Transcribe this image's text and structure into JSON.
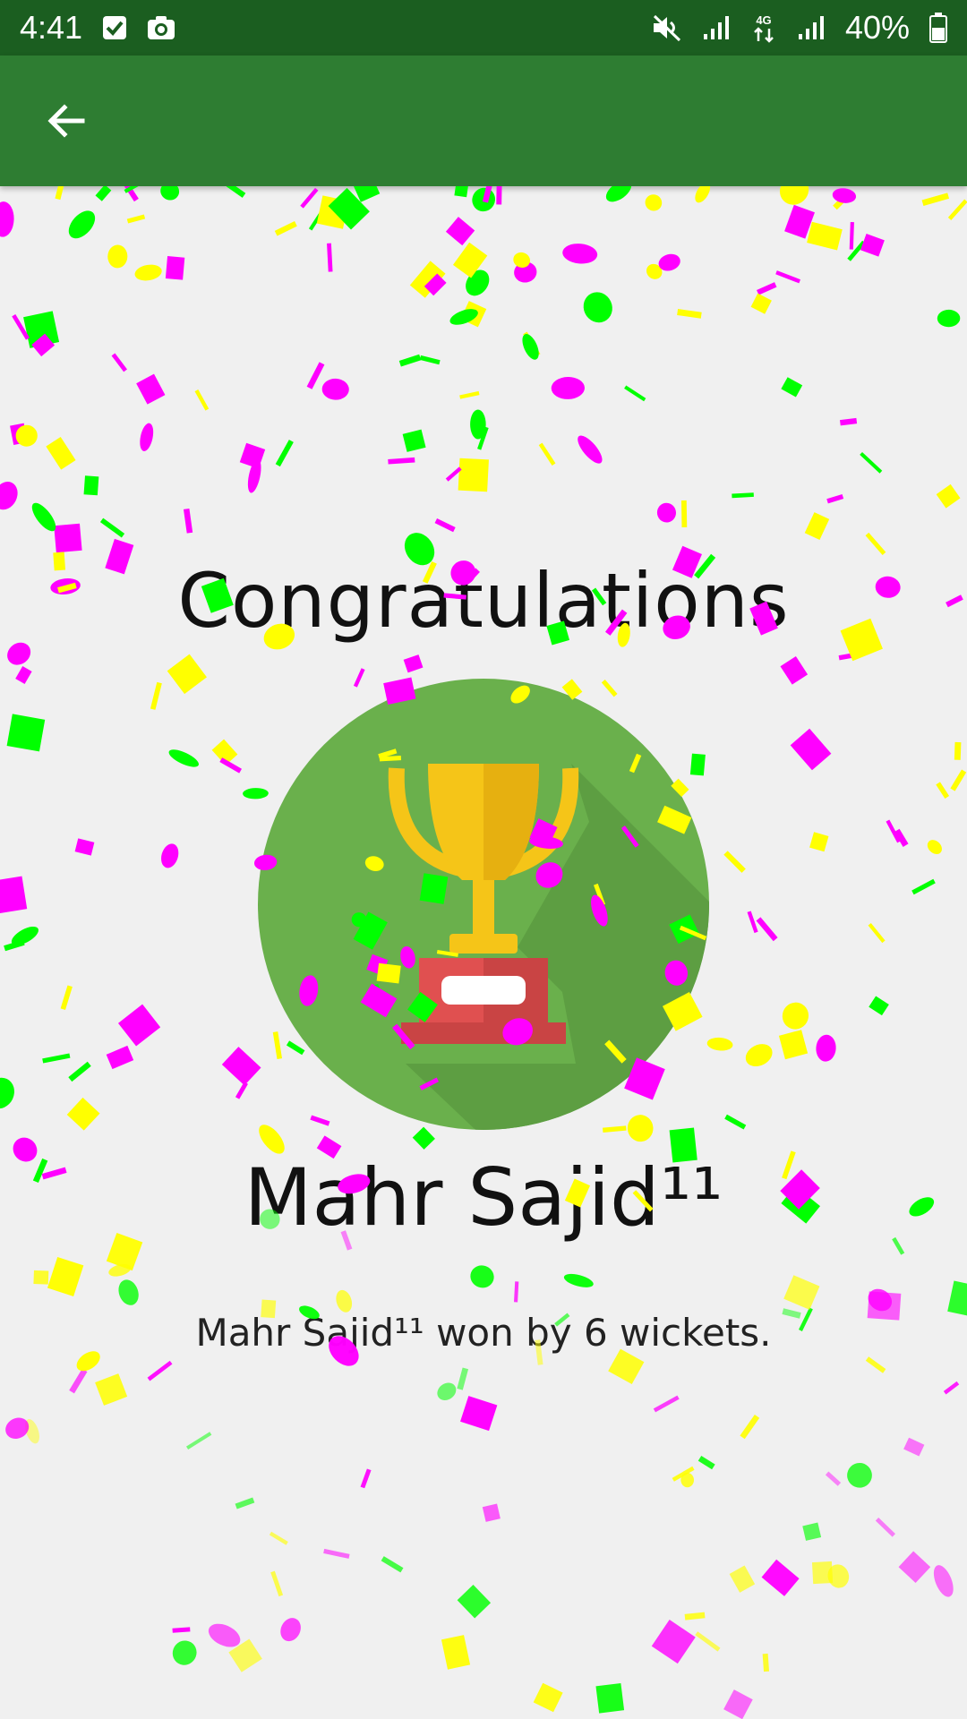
{
  "status_bar": {
    "time": "4:41",
    "battery": "40%",
    "icons": [
      "check-box-icon",
      "camera-icon",
      "mute-icon",
      "signal-icon",
      "4g-icon",
      "signal-icon",
      "battery-icon"
    ]
  },
  "toolbar": {
    "back_icon": "arrow-left-icon"
  },
  "main": {
    "title": "Congratulations",
    "winner": "Mahr Sajid¹¹",
    "result": "Mahr Sajid¹¹ won by 6 wickets."
  },
  "colors": {
    "status_bar": "#1b5e20",
    "toolbar": "#2e7d32",
    "background": "#f0f0f0",
    "circle": "#6ab04c",
    "trophy_gold": "#f5c518",
    "trophy_base": "#e05050",
    "confetti": [
      "#ff00ff",
      "#00ff00",
      "#ffff00"
    ]
  }
}
